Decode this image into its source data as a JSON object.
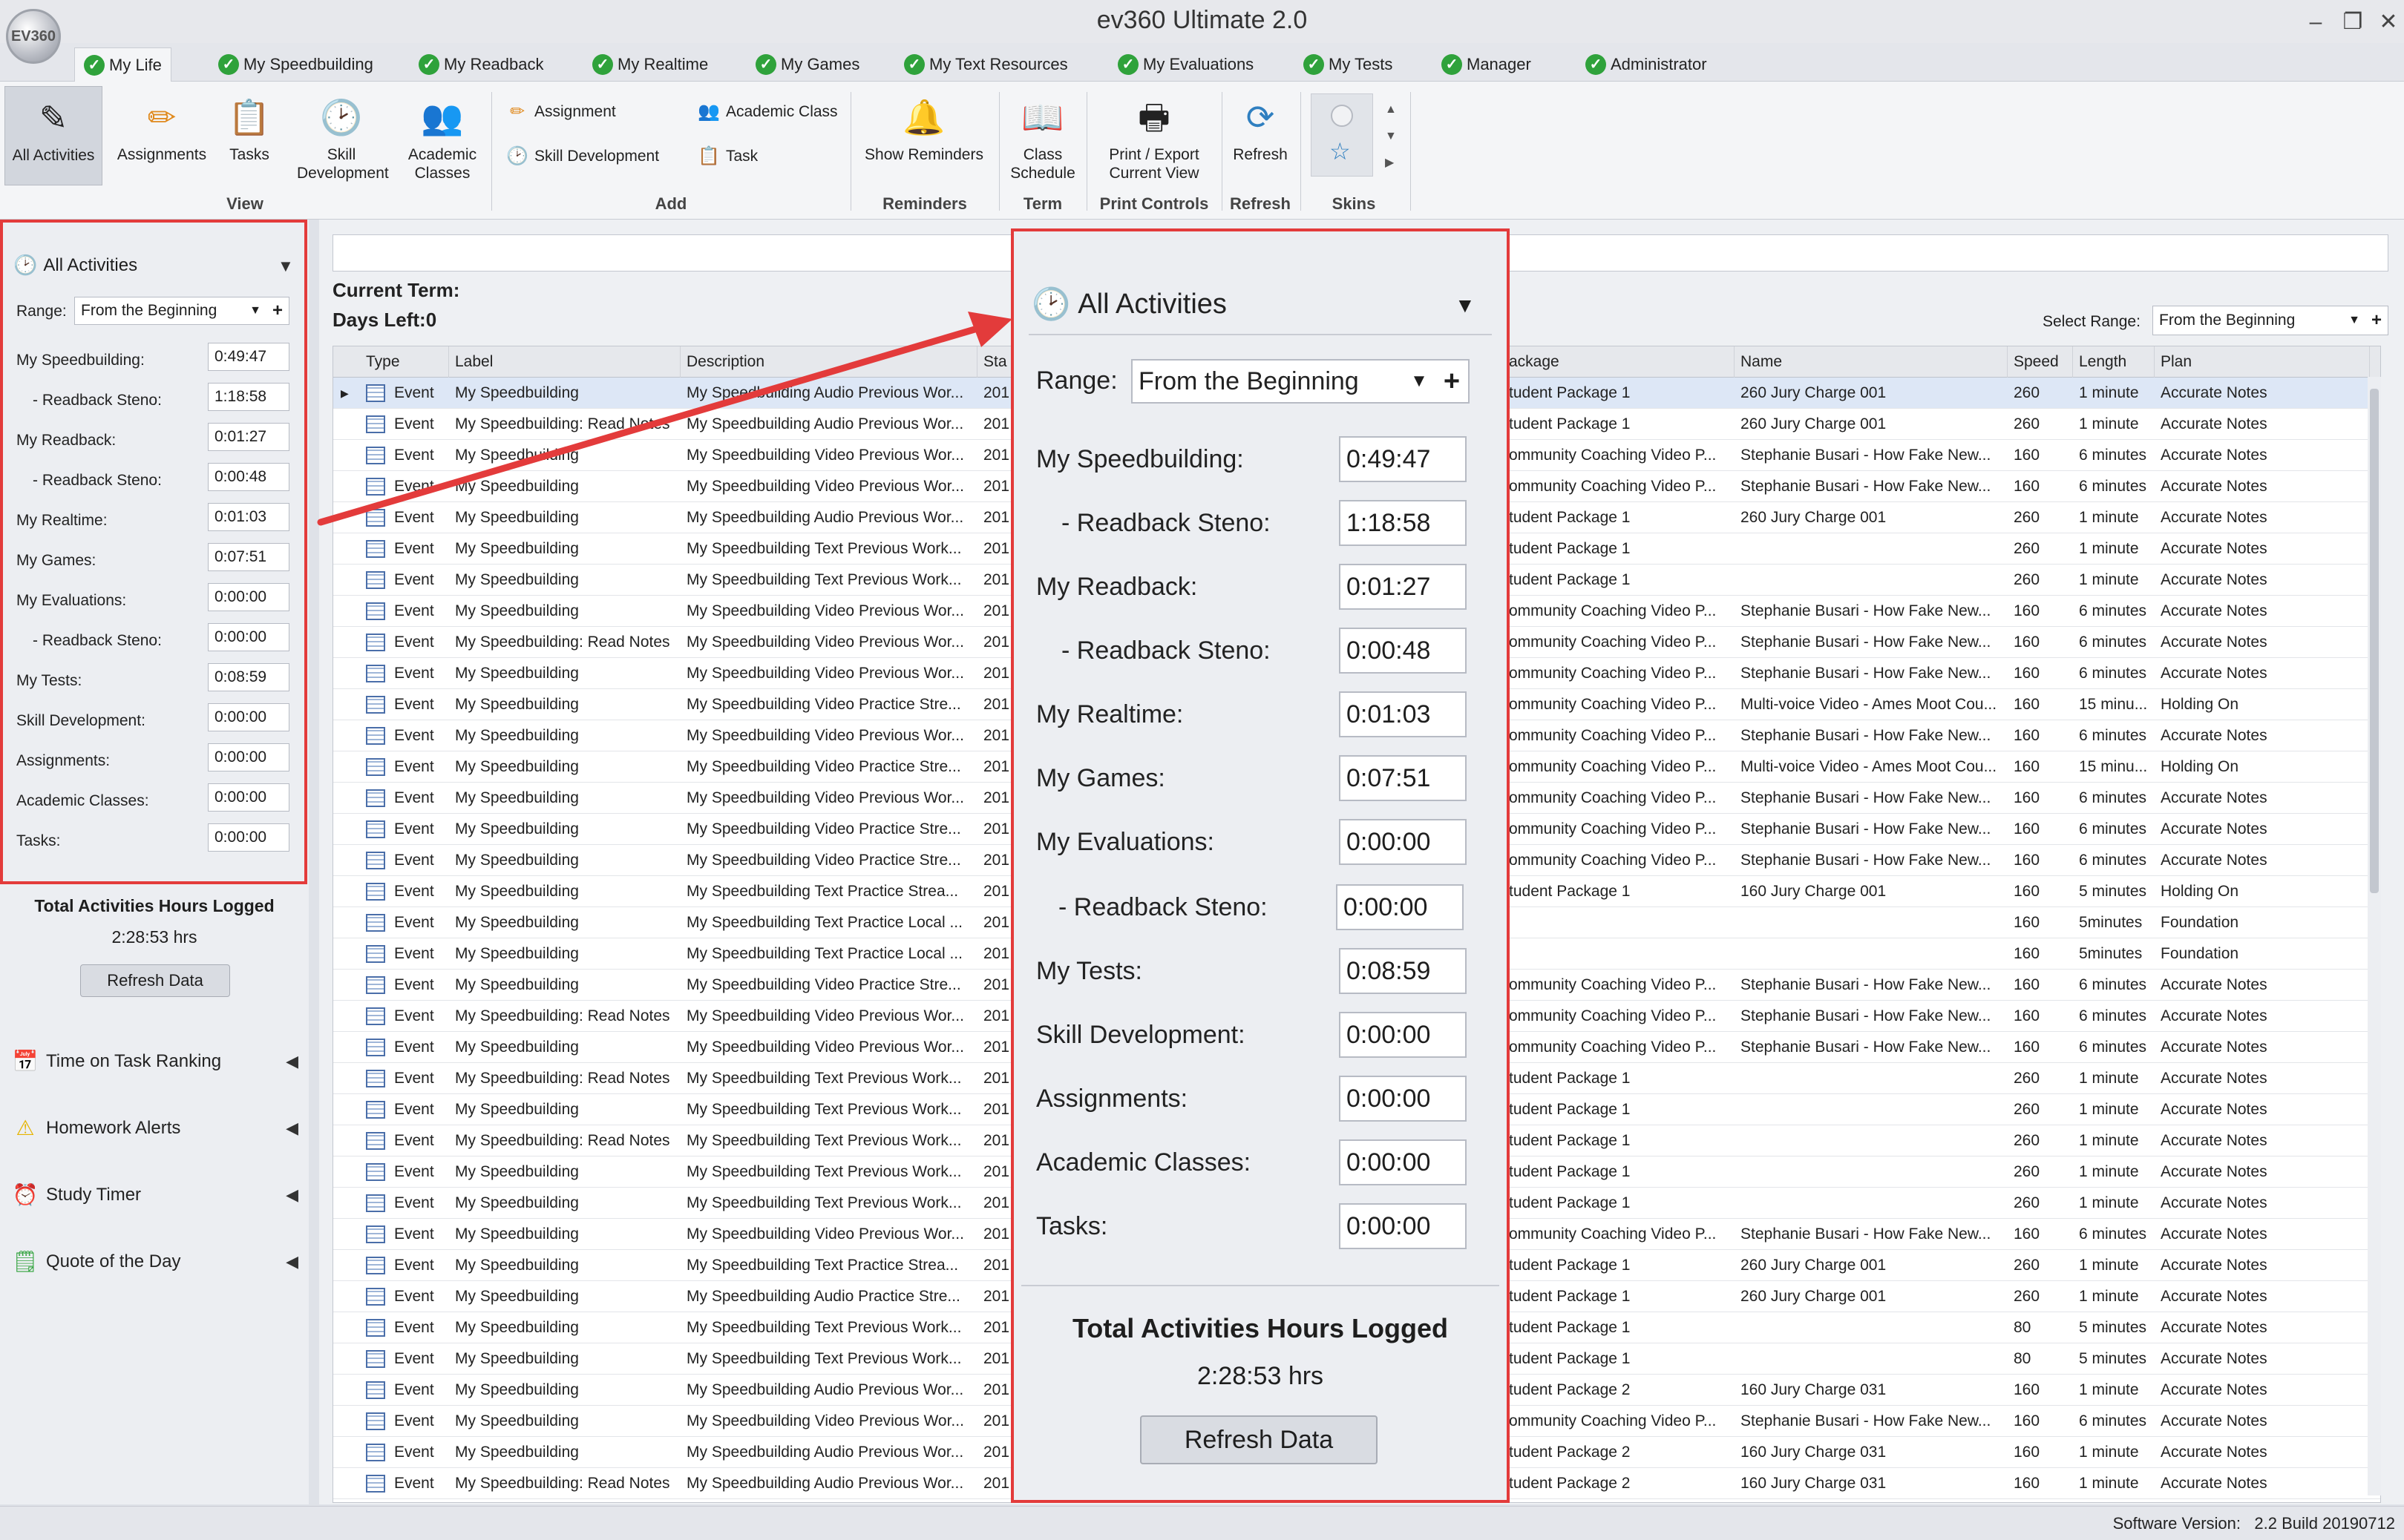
{
  "window": {
    "title": "ev360 Ultimate 2.0",
    "logo_text": "EV360",
    "minimize": "–",
    "restore": "❐",
    "close": "✕"
  },
  "menu_tabs": [
    {
      "label": "My Life",
      "active": true
    },
    {
      "label": "My Speedbuilding"
    },
    {
      "label": "My Readback"
    },
    {
      "label": "My Realtime"
    },
    {
      "label": "My Games"
    },
    {
      "label": "My Text Resources"
    },
    {
      "label": "My Evaluations"
    },
    {
      "label": "My Tests"
    },
    {
      "label": "Manager"
    },
    {
      "label": "Administrator"
    }
  ],
  "ribbon": {
    "view": {
      "group": "View",
      "buttons": [
        "All Activities",
        "Assignments",
        "Tasks",
        "Skill Development",
        "Academic Classes"
      ]
    },
    "add": {
      "group": "Add",
      "items": [
        "Assignment",
        "Skill Development",
        "Academic Class",
        "Task"
      ]
    },
    "reminders": {
      "group": "Reminders",
      "button": "Show Reminders"
    },
    "term": {
      "group": "Term",
      "button": "Class Schedule"
    },
    "print": {
      "group": "Print Controls",
      "button": "Print / Export Current View"
    },
    "refresh": {
      "group": "Refresh",
      "button": "Refresh"
    },
    "skins": {
      "group": "Skins"
    }
  },
  "left_panel": {
    "header": "All Activities",
    "range_label": "Range:",
    "range_value": "From the Beginning",
    "stats": [
      {
        "label": "My Speedbuilding:",
        "value": "0:49:47"
      },
      {
        "label": "- Readback Steno:",
        "value": "1:18:58",
        "indent": true
      },
      {
        "label": "My Readback:",
        "value": "0:01:27"
      },
      {
        "label": "- Readback Steno:",
        "value": "0:00:48",
        "indent": true
      },
      {
        "label": "My Realtime:",
        "value": "0:01:03"
      },
      {
        "label": "My Games:",
        "value": "0:07:51"
      },
      {
        "label": "My Evaluations:",
        "value": "0:00:00"
      },
      {
        "label": "- Readback Steno:",
        "value": "0:00:00",
        "indent": true
      },
      {
        "label": "My Tests:",
        "value": "0:08:59"
      },
      {
        "label": "Skill Development:",
        "value": "0:00:00"
      },
      {
        "label": "Assignments:",
        "value": "0:00:00"
      },
      {
        "label": "Academic Classes:",
        "value": "0:00:00"
      },
      {
        "label": "Tasks:",
        "value": "0:00:00"
      }
    ],
    "total_label": "Total Activities Hours Logged",
    "total_value": "2:28:53 hrs",
    "refresh_button": "Refresh Data",
    "links": [
      "Time on Task Ranking",
      "Homework Alerts",
      "Study Timer",
      "Quote of the Day"
    ]
  },
  "main": {
    "current_term_label": "Current Term:",
    "days_left_label": "Days Left:0",
    "select_range_label": "Select Range:",
    "select_range_value": "From the Beginning"
  },
  "grid": {
    "columns": [
      "Type",
      "Label",
      "Description",
      "Sta",
      "ackage",
      "Name",
      "Speed",
      "Length",
      "Plan"
    ],
    "rows": [
      [
        "Event",
        "My Speedbuilding",
        "My Speedbuilding Audio Previous Wor...",
        "201",
        "tudent Package 1",
        "260 Jury Charge 001",
        "260",
        "1 minute",
        "Accurate Notes"
      ],
      [
        "Event",
        "My Speedbuilding: Read Notes",
        "My Speedbuilding Audio Previous Wor...",
        "201",
        "tudent Package 1",
        "260 Jury Charge 001",
        "260",
        "1 minute",
        "Accurate Notes"
      ],
      [
        "Event",
        "My Speedbuilding",
        "My Speedbuilding Video Previous Wor...",
        "201",
        "ommunity Coaching Video P...",
        "Stephanie Busari - How Fake New...",
        "160",
        "6 minutes",
        "Accurate Notes"
      ],
      [
        "Event",
        "My Speedbuilding",
        "My Speedbuilding Video Previous Wor...",
        "201",
        "ommunity Coaching Video P...",
        "Stephanie Busari - How Fake New...",
        "160",
        "6 minutes",
        "Accurate Notes"
      ],
      [
        "Event",
        "My Speedbuilding",
        "My Speedbuilding Audio Previous Wor...",
        "201",
        "tudent Package 1",
        "260 Jury Charge 001",
        "260",
        "1 minute",
        "Accurate Notes"
      ],
      [
        "Event",
        "My Speedbuilding",
        "My Speedbuilding Text Previous Work...",
        "201",
        "tudent Package 1",
        "",
        "260",
        "1 minute",
        "Accurate Notes"
      ],
      [
        "Event",
        "My Speedbuilding",
        "My Speedbuilding Text Previous Work...",
        "201",
        "tudent Package 1",
        "",
        "260",
        "1 minute",
        "Accurate Notes"
      ],
      [
        "Event",
        "My Speedbuilding",
        "My Speedbuilding Video Previous Wor...",
        "201",
        "ommunity Coaching Video P...",
        "Stephanie Busari - How Fake New...",
        "160",
        "6 minutes",
        "Accurate Notes"
      ],
      [
        "Event",
        "My Speedbuilding: Read Notes",
        "My Speedbuilding Video Previous Wor...",
        "201",
        "ommunity Coaching Video P...",
        "Stephanie Busari - How Fake New...",
        "160",
        "6 minutes",
        "Accurate Notes"
      ],
      [
        "Event",
        "My Speedbuilding",
        "My Speedbuilding Video Previous Wor...",
        "201",
        "ommunity Coaching Video P...",
        "Stephanie Busari - How Fake New...",
        "160",
        "6 minutes",
        "Accurate Notes"
      ],
      [
        "Event",
        "My Speedbuilding",
        "My Speedbuilding Video Practice Stre...",
        "201",
        "ommunity Coaching Video P...",
        "Multi-voice Video - Ames Moot Cou...",
        "160",
        "15 minu...",
        "Holding On"
      ],
      [
        "Event",
        "My Speedbuilding",
        "My Speedbuilding Video Previous Wor...",
        "201",
        "ommunity Coaching Video P...",
        "Stephanie Busari - How Fake New...",
        "160",
        "6 minutes",
        "Accurate Notes"
      ],
      [
        "Event",
        "My Speedbuilding",
        "My Speedbuilding Video Practice Stre...",
        "201",
        "ommunity Coaching Video P...",
        "Multi-voice Video - Ames Moot Cou...",
        "160",
        "15 minu...",
        "Holding On"
      ],
      [
        "Event",
        "My Speedbuilding",
        "My Speedbuilding Video Previous Wor...",
        "201",
        "ommunity Coaching Video P...",
        "Stephanie Busari - How Fake New...",
        "160",
        "6 minutes",
        "Accurate Notes"
      ],
      [
        "Event",
        "My Speedbuilding",
        "My Speedbuilding Video Practice Stre...",
        "201",
        "ommunity Coaching Video P...",
        "Stephanie Busari - How Fake New...",
        "160",
        "6 minutes",
        "Accurate Notes"
      ],
      [
        "Event",
        "My Speedbuilding",
        "My Speedbuilding Video Practice Stre...",
        "201",
        "ommunity Coaching Video P...",
        "Stephanie Busari - How Fake New...",
        "160",
        "6 minutes",
        "Accurate Notes"
      ],
      [
        "Event",
        "My Speedbuilding",
        "My Speedbuilding Text Practice Strea...",
        "201",
        "tudent Package 1",
        "160 Jury Charge 001",
        "160",
        "5 minutes",
        "Holding On"
      ],
      [
        "Event",
        "My Speedbuilding",
        "My Speedbuilding Text Practice Local ...",
        "201",
        "",
        "",
        "160",
        "5minutes",
        "Foundation"
      ],
      [
        "Event",
        "My Speedbuilding",
        "My Speedbuilding Text Practice Local ...",
        "201",
        "",
        "",
        "160",
        "5minutes",
        "Foundation"
      ],
      [
        "Event",
        "My Speedbuilding",
        "My Speedbuilding Video Practice Stre...",
        "201",
        "ommunity Coaching Video P...",
        "Stephanie Busari - How Fake New...",
        "160",
        "6 minutes",
        "Accurate Notes"
      ],
      [
        "Event",
        "My Speedbuilding: Read Notes",
        "My Speedbuilding Video Previous Wor...",
        "201",
        "ommunity Coaching Video P...",
        "Stephanie Busari - How Fake New...",
        "160",
        "6 minutes",
        "Accurate Notes"
      ],
      [
        "Event",
        "My Speedbuilding",
        "My Speedbuilding Video Previous Wor...",
        "201",
        "ommunity Coaching Video P...",
        "Stephanie Busari - How Fake New...",
        "160",
        "6 minutes",
        "Accurate Notes"
      ],
      [
        "Event",
        "My Speedbuilding: Read Notes",
        "My Speedbuilding Text Previous Work...",
        "201",
        "tudent Package 1",
        "",
        "260",
        "1 minute",
        "Accurate Notes"
      ],
      [
        "Event",
        "My Speedbuilding",
        "My Speedbuilding Text Previous Work...",
        "201",
        "tudent Package 1",
        "",
        "260",
        "1 minute",
        "Accurate Notes"
      ],
      [
        "Event",
        "My Speedbuilding: Read Notes",
        "My Speedbuilding Text Previous Work...",
        "201",
        "tudent Package 1",
        "",
        "260",
        "1 minute",
        "Accurate Notes"
      ],
      [
        "Event",
        "My Speedbuilding",
        "My Speedbuilding Text Previous Work...",
        "201",
        "tudent Package 1",
        "",
        "260",
        "1 minute",
        "Accurate Notes"
      ],
      [
        "Event",
        "My Speedbuilding",
        "My Speedbuilding Text Previous Work...",
        "201",
        "tudent Package 1",
        "",
        "260",
        "1 minute",
        "Accurate Notes"
      ],
      [
        "Event",
        "My Speedbuilding",
        "My Speedbuilding Video Previous Wor...",
        "201",
        "ommunity Coaching Video P...",
        "Stephanie Busari - How Fake New...",
        "160",
        "6 minutes",
        "Accurate Notes"
      ],
      [
        "Event",
        "My Speedbuilding",
        "My Speedbuilding Text Practice Strea...",
        "201",
        "tudent Package 1",
        "260 Jury Charge 001",
        "260",
        "1 minute",
        "Accurate Notes"
      ],
      [
        "Event",
        "My Speedbuilding",
        "My Speedbuilding Audio Practice Stre...",
        "201",
        "tudent Package 1",
        "260 Jury Charge 001",
        "260",
        "1 minute",
        "Accurate Notes"
      ],
      [
        "Event",
        "My Speedbuilding",
        "My Speedbuilding Text Previous Work...",
        "201",
        "tudent Package 1",
        "",
        "80",
        "5 minutes",
        "Accurate Notes"
      ],
      [
        "Event",
        "My Speedbuilding",
        "My Speedbuilding Text Previous Work...",
        "201",
        "tudent Package 1",
        "",
        "80",
        "5 minutes",
        "Accurate Notes"
      ],
      [
        "Event",
        "My Speedbuilding",
        "My Speedbuilding Audio Previous Wor...",
        "201",
        "tudent Package 2",
        "160 Jury Charge 031",
        "160",
        "1 minute",
        "Accurate Notes"
      ],
      [
        "Event",
        "My Speedbuilding",
        "My Speedbuilding Video Previous Wor...",
        "201",
        "ommunity Coaching Video P...",
        "Stephanie Busari - How Fake New...",
        "160",
        "6 minutes",
        "Accurate Notes"
      ],
      [
        "Event",
        "My Speedbuilding",
        "My Speedbuilding Audio Previous Wor...",
        "201",
        "tudent Package 2",
        "160 Jury Charge 031",
        "160",
        "1 minute",
        "Accurate Notes"
      ],
      [
        "Event",
        "My Speedbuilding: Read Notes",
        "My Speedbuilding Audio Previous Wor...",
        "201",
        "tudent Package 2",
        "160 Jury Charge 031",
        "160",
        "1 minute",
        "Accurate Notes"
      ]
    ]
  },
  "status": {
    "version_label": "Software Version:",
    "version_value": "2.2 Build 20190712"
  },
  "colors": {
    "highlight": "#e33b3b",
    "check": "#2fa23b"
  }
}
